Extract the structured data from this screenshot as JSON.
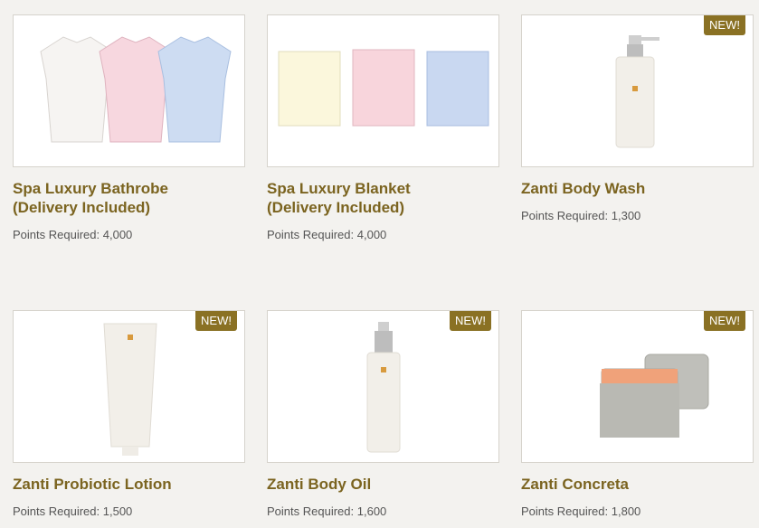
{
  "colors": {
    "accent": "#7b6420",
    "badge": "#8a7124"
  },
  "products": [
    {
      "title_line1": "Spa Luxury Bathrobe",
      "title_line2": "(Delivery Included)",
      "points_label": "Points Required:",
      "points": "4,000",
      "badge": ""
    },
    {
      "title_line1": "Spa Luxury Blanket",
      "title_line2": "(Delivery Included)",
      "points_label": "Points Required:",
      "points": "4,000",
      "badge": ""
    },
    {
      "title_line1": "Zanti Body Wash",
      "title_line2": "",
      "points_label": "Points Required:",
      "points": "1,300",
      "badge": "NEW!"
    },
    {
      "title_line1": "Zanti Probiotic Lotion",
      "title_line2": "",
      "points_label": "Points Required:",
      "points": "1,500",
      "badge": "NEW!"
    },
    {
      "title_line1": "Zanti Body Oil",
      "title_line2": "",
      "points_label": "Points Required:",
      "points": "1,600",
      "badge": "NEW!"
    },
    {
      "title_line1": "Zanti Concreta",
      "title_line2": "",
      "points_label": "Points Required:",
      "points": "1,800",
      "badge": "NEW!"
    }
  ]
}
